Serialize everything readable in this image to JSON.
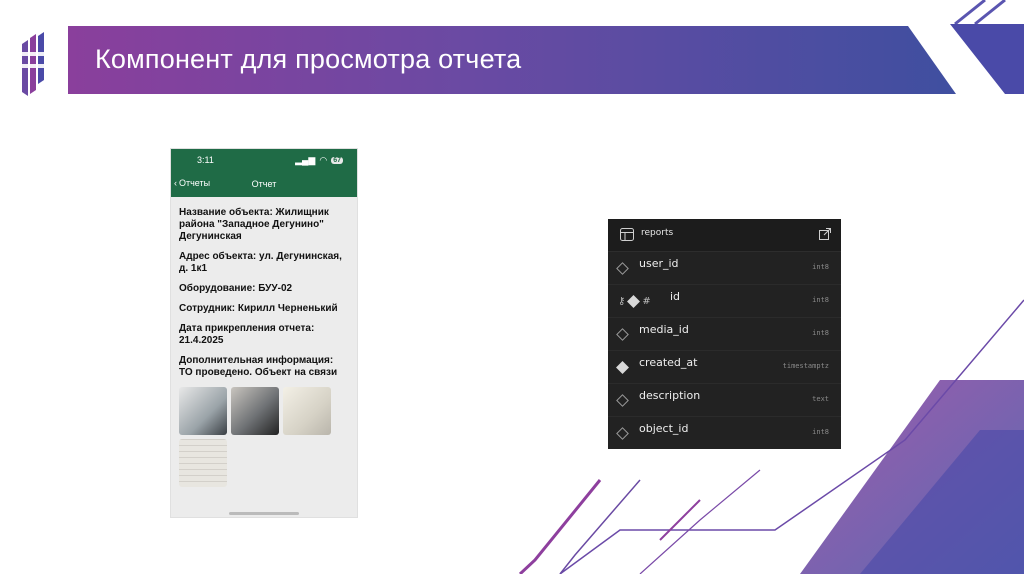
{
  "slide": {
    "title": "Компонент для просмотра отчета"
  },
  "colors": {
    "title_gradient_start": "#8a3f9c",
    "title_gradient_end": "#3f4fa0",
    "phone_header": "#1f6b46",
    "db_background": "#1c1c1c"
  },
  "phone": {
    "status_time": "3:11",
    "battery": "67",
    "nav_back_label": "Отчеты",
    "nav_title": "Отчет",
    "details": [
      "Название объекта: Жилищник района \"Западное Дегунино\" Дегунинская",
      "Адрес объекта: ул. Дегунинская, д. 1к1",
      "Оборудование: БУУ-02",
      "Сотрудник: Кирилл Черненький",
      "Дата прикрепления отчета: 21.4.2025",
      "Дополнительная информация: ТО проведено. Объект на связи"
    ]
  },
  "db_table": {
    "name": "reports",
    "columns": [
      {
        "name": "user_id",
        "type": "int8",
        "icon": "diamond-outline-icon"
      },
      {
        "name": "id",
        "type": "int8",
        "icon": "key-diamond-hash-icon"
      },
      {
        "name": "media_id",
        "type": "int8",
        "icon": "diamond-outline-icon"
      },
      {
        "name": "created_at",
        "type": "timestamptz",
        "icon": "diamond-filled-icon"
      },
      {
        "name": "description",
        "type": "text",
        "icon": "diamond-outline-icon"
      },
      {
        "name": "object_id",
        "type": "int8",
        "icon": "diamond-outline-icon"
      }
    ]
  }
}
